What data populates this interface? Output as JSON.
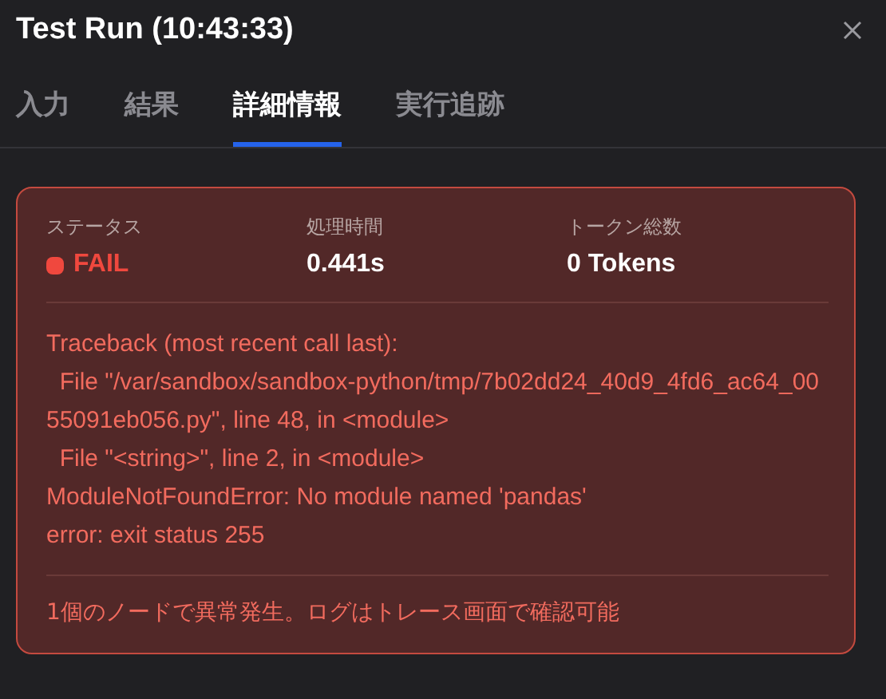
{
  "window": {
    "title": "Test Run (10:43:33)"
  },
  "tabs": [
    {
      "label": "入力",
      "selected": false
    },
    {
      "label": "結果",
      "selected": false
    },
    {
      "label": "詳細情報",
      "selected": true
    },
    {
      "label": "実行追跡",
      "selected": false
    }
  ],
  "stats": [
    {
      "label": "ステータス",
      "value": "FAIL",
      "kind": "status",
      "color": "#f0483e"
    },
    {
      "label": "処理時間",
      "value": "0.441s",
      "kind": "plain"
    },
    {
      "label": "トークン総数",
      "value": "0 Tokens",
      "kind": "plain"
    }
  ],
  "error_lines": [
    "Traceback (most recent call last):",
    "  File \"/var/sandbox/sandbox-python/tmp/7b02dd24_40d9_4fd6_ac64_0055091eb056.py\", line 48, in <module>",
    "  File \"<string>\", line 2, in <module>",
    "ModuleNotFoundError: No module named 'pandas'",
    "error: exit status 255"
  ],
  "footer_message": "1個のノードで異常発生。ログはトレース画面で確認可能"
}
